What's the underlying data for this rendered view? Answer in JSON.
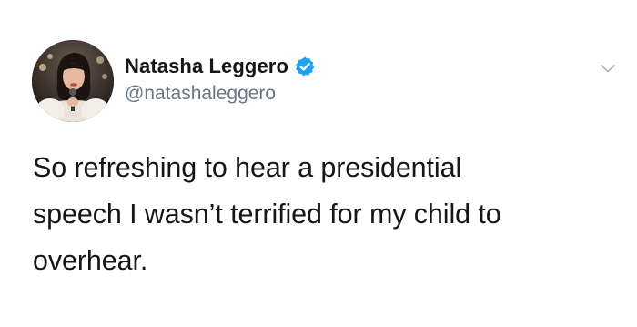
{
  "tweet": {
    "author": {
      "display_name": "Natasha Leggero",
      "handle": "@natashaleggero",
      "verified": true
    },
    "body": "So refreshing to hear a presidential\nspeech I wasn’t terrified for my child to\noverhear."
  },
  "colors": {
    "verified_badge": "#1da1f2",
    "name_text": "#14171a",
    "handle_text": "#657786",
    "caret": "#aab8c2"
  },
  "icons": {
    "verified": "verified-badge-icon",
    "menu": "chevron-down-icon"
  }
}
